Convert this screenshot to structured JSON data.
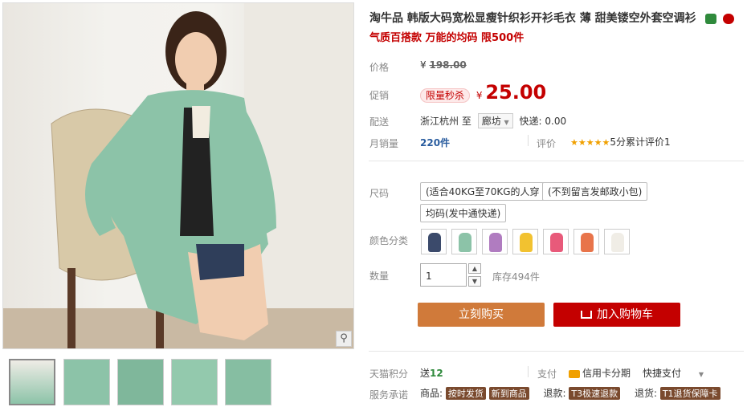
{
  "product": {
    "title": "淘牛品 韩版大码宽松显瘦针织衫开衫毛衣 薄 甜美镂空外套空调衫",
    "subtitle": "气质百搭款 万能的均码 限500件"
  },
  "price": {
    "label": "价格",
    "currency": "¥",
    "original": "198.00",
    "promo_label": "促销",
    "promo_badge": "限量秒杀",
    "promo_value": "25.00"
  },
  "shipping": {
    "label": "配送",
    "from": "浙江杭州",
    "to_word": "至",
    "dest": "廊坊",
    "method": "快递: 0.00"
  },
  "sales": {
    "label": "月销量",
    "value": "220件",
    "rating_label": "评价",
    "stars": "★★★★★",
    "rating_text": "5分累计评价1"
  },
  "size": {
    "label": "尺码",
    "options": [
      "(适合40KG至70KG的人穿",
      "(不到留言发邮政小包)",
      "均码(发中通快递)"
    ]
  },
  "color": {
    "label": "颜色分类",
    "swatch_colors": [
      "#3b4a6b",
      "#8cc3a8",
      "#b07cc0",
      "#f2c230",
      "#e85a7a",
      "#e8744a",
      "#f0ede6"
    ]
  },
  "quantity": {
    "label": "数量",
    "value": "1",
    "stock": "库存494件"
  },
  "buttons": {
    "buy": "立刻购买",
    "cart": "加入购物车",
    "buy_color": "#d07a3a",
    "cart_color": "#c40000"
  },
  "tmall": {
    "points_label": "天猫积分",
    "points_prefix": "送",
    "points_value": "12",
    "pay_label": "支付",
    "credit": "信用卡分期",
    "fast_pay": "快捷支付"
  },
  "service": {
    "label": "服务承诺",
    "goods_label": "商品:",
    "tag1": "按时发货",
    "tag2": "新到商品",
    "refund_label": "退款:",
    "tag3": "T3极速退款",
    "return_label": "退货:",
    "tag4": "T1退货保障卡"
  }
}
